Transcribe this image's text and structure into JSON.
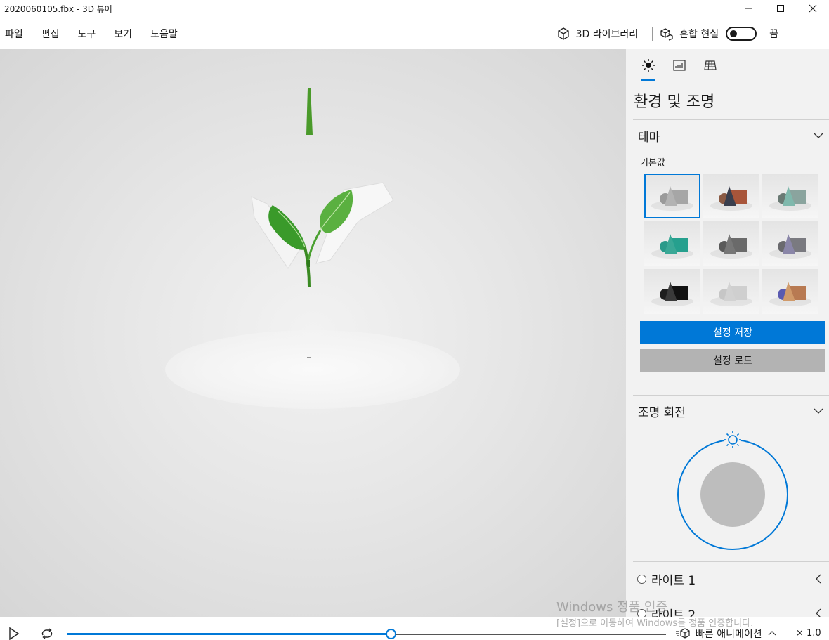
{
  "window": {
    "title": "2020060105.fbx - 3D 뷰어"
  },
  "menu": {
    "items": [
      "파일",
      "편집",
      "도구",
      "보기",
      "도움말"
    ],
    "library_label": "3D 라이브러리",
    "mixed_reality_label": "혼합 현실",
    "toggle_state": "끔"
  },
  "panel": {
    "title": "환경 및 조명",
    "theme_section": "테마",
    "theme_default_label": "기본값",
    "themes": [
      {
        "sphere": "#9a9a9a",
        "cone": "#b3b3b3",
        "cube": "#a6a6a6"
      },
      {
        "sphere": "#8a5a44",
        "cone": "#3a3f4e",
        "cube": "#a8553a"
      },
      {
        "sphere": "#6a7a74",
        "cone": "#7fb8ac",
        "cube": "#8aa49e"
      },
      {
        "sphere": "#2a9a8a",
        "cone": "#3aa896",
        "cube": "#26a08e"
      },
      {
        "sphere": "#5a5a5a",
        "cone": "#777777",
        "cube": "#6a6a6a"
      },
      {
        "sphere": "#6a6a6e",
        "cone": "#8a86a8",
        "cube": "#7a7a80"
      },
      {
        "sphere": "#1e1e1e",
        "cone": "#3a3a3a",
        "cube": "#111111"
      },
      {
        "sphere": "#c6c6c6",
        "cone": "#d2d2d2",
        "cube": "#cfcfcf"
      },
      {
        "sphere": "#5a5ab0",
        "cone": "#d09a6a",
        "cube": "#b87a52"
      }
    ],
    "save_label": "설정 저장",
    "load_label": "설정 로드",
    "light_rotation_section": "조명 회전",
    "light1_label": "라이트 1",
    "light2_label": "라이트 2"
  },
  "playback": {
    "progress": 0.54,
    "quick_animation_label": "빠른 애니메이션",
    "speed_label": "× 1.0"
  },
  "watermark": {
    "line1": "Windows 정품 인증",
    "line2": "[설정]으로 이동하여 Windows를 정품 인증합니다."
  },
  "colors": {
    "accent": "#0078d7",
    "leaf_dark": "#2e8a24",
    "leaf_light": "#6cc04a"
  }
}
